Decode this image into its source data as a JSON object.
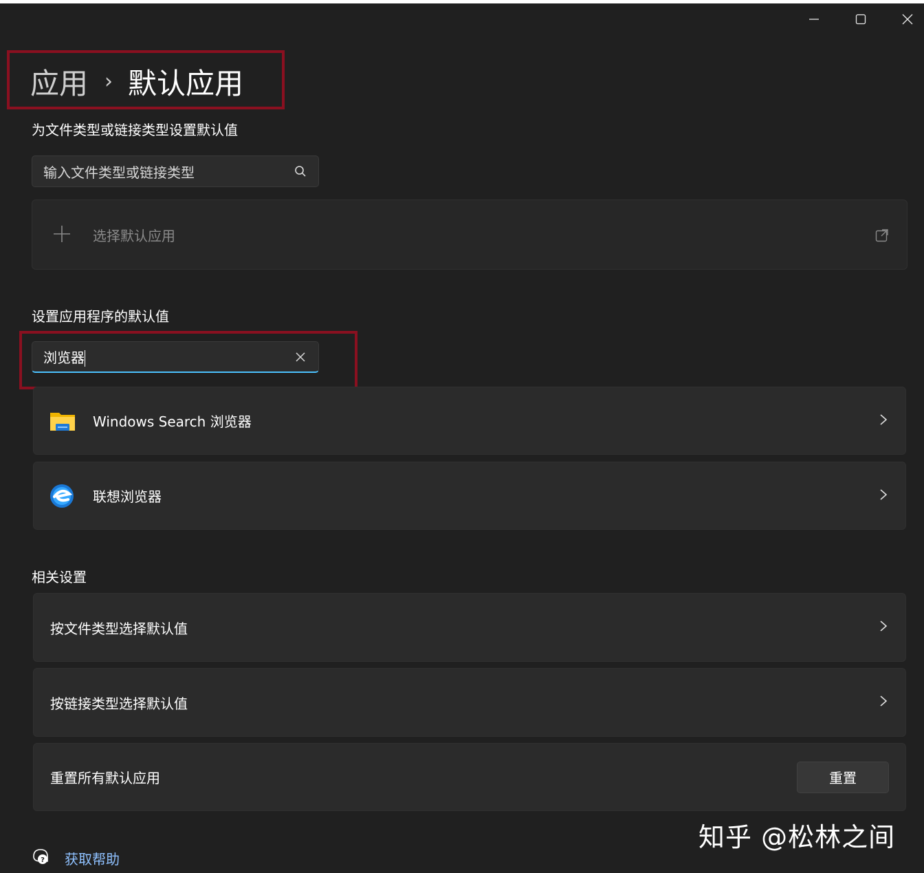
{
  "window": {
    "controls": [
      {
        "name": "minimize",
        "icon": "minimize-icon"
      },
      {
        "name": "maximize",
        "icon": "maximize-icon"
      },
      {
        "name": "close",
        "icon": "close-icon"
      }
    ]
  },
  "breadcrumb": {
    "parent": "应用",
    "separator": "›",
    "current": "默认应用"
  },
  "file_type_section": {
    "label": "为文件类型或链接类型设置默认值",
    "search": {
      "value": "输入文件类型或链接类型",
      "icon": "search-icon"
    },
    "choose_default": {
      "label": "选择默认应用",
      "icon": "plus-icon",
      "trailing_icon": "open-external-icon"
    }
  },
  "app_defaults_section": {
    "label": "设置应用程序的默认值",
    "search": {
      "value": "浏览器",
      "icon": "clear-icon"
    },
    "results": [
      {
        "name": "Windows Search 浏览器",
        "icon": "folder-icon"
      },
      {
        "name": "联想浏览器",
        "icon": "lenovo-browser-icon"
      }
    ]
  },
  "related_settings": {
    "label": "相关设置",
    "items": [
      {
        "label": "按文件类型选择默认值"
      },
      {
        "label": "按链接类型选择默认值"
      },
      {
        "label": "重置所有默认应用",
        "button": "重置"
      }
    ]
  },
  "help": {
    "label": "获取帮助",
    "icon": "help-icon"
  },
  "watermark": "知乎 @松林之间",
  "colors": {
    "background": "#202020",
    "card": "#2b2b2b",
    "accent_underline": "#4cc2ff",
    "highlight_box": "#8a1020",
    "link": "#8fc1ff"
  }
}
